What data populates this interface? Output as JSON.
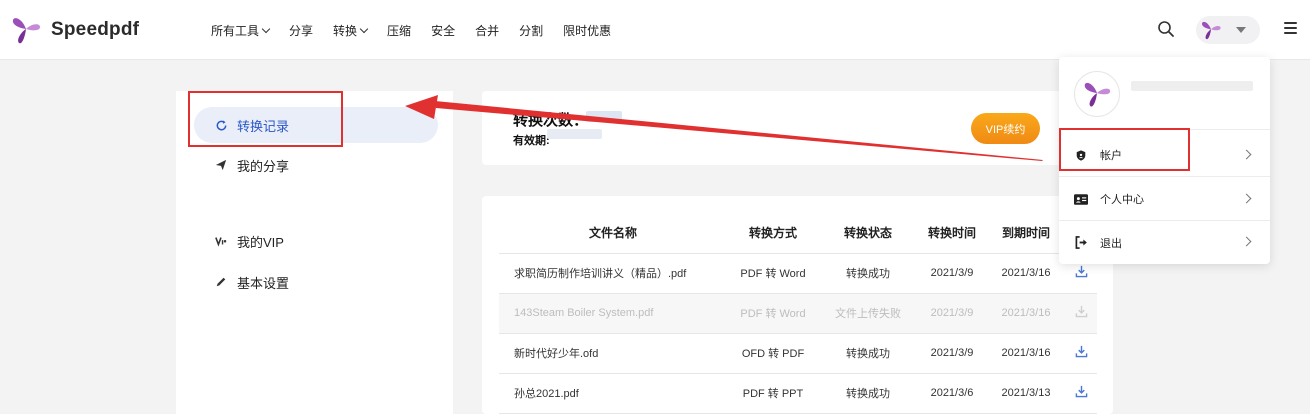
{
  "header": {
    "logo_text": "Speedpdf",
    "nav": [
      {
        "label": "所有工具",
        "dropdown": true
      },
      {
        "label": "分享",
        "dropdown": false
      },
      {
        "label": "转换",
        "dropdown": true
      },
      {
        "label": "压缩",
        "dropdown": false
      },
      {
        "label": "安全",
        "dropdown": false
      },
      {
        "label": "合并",
        "dropdown": false
      },
      {
        "label": "分割",
        "dropdown": false
      },
      {
        "label": "限时优惠",
        "dropdown": false
      }
    ]
  },
  "sidebar": {
    "items": [
      {
        "label": "转换记录",
        "icon": "refresh-icon",
        "active": true
      },
      {
        "label": "我的分享",
        "icon": "paper-plane-icon",
        "active": false
      },
      {
        "label": "我的VIP",
        "icon": "vip-icon",
        "active": false
      },
      {
        "label": "基本设置",
        "icon": "pencil-icon",
        "active": false
      }
    ]
  },
  "info": {
    "count_label": "转换次数：",
    "expiry_label": "有效期:",
    "vip_button": "VIP续约"
  },
  "table": {
    "headers": [
      "文件名称",
      "转换方式",
      "转换状态",
      "转换时间",
      "到期时间",
      ""
    ],
    "rows": [
      {
        "name": "求职简历制作培训讲义（精品）.pdf",
        "method": "PDF 转 Word",
        "status": "转换成功",
        "time": "2021/3/9",
        "expire": "2021/3/16",
        "failed": false
      },
      {
        "name": "143Steam Boiler System.pdf",
        "method": "PDF 转 Word",
        "status": "文件上传失败",
        "time": "2021/3/9",
        "expire": "2021/3/16",
        "failed": true
      },
      {
        "name": "新时代好少年.ofd",
        "method": "OFD 转 PDF",
        "status": "转换成功",
        "time": "2021/3/9",
        "expire": "2021/3/16",
        "failed": false
      },
      {
        "name": "孙总2021.pdf",
        "method": "PDF 转 PPT",
        "status": "转换成功",
        "time": "2021/3/6",
        "expire": "2021/3/13",
        "failed": false
      }
    ]
  },
  "dropdown": {
    "items": [
      {
        "label": "帐户",
        "icon": "shield-icon"
      },
      {
        "label": "个人中心",
        "icon": "id-card-icon"
      },
      {
        "label": "退出",
        "icon": "logout-icon"
      }
    ]
  },
  "colors": {
    "accent": "#2b58c8",
    "annotation": "#e0302f",
    "vip_orange": "#f5961a",
    "brand_purple": "#8e3fa8"
  }
}
